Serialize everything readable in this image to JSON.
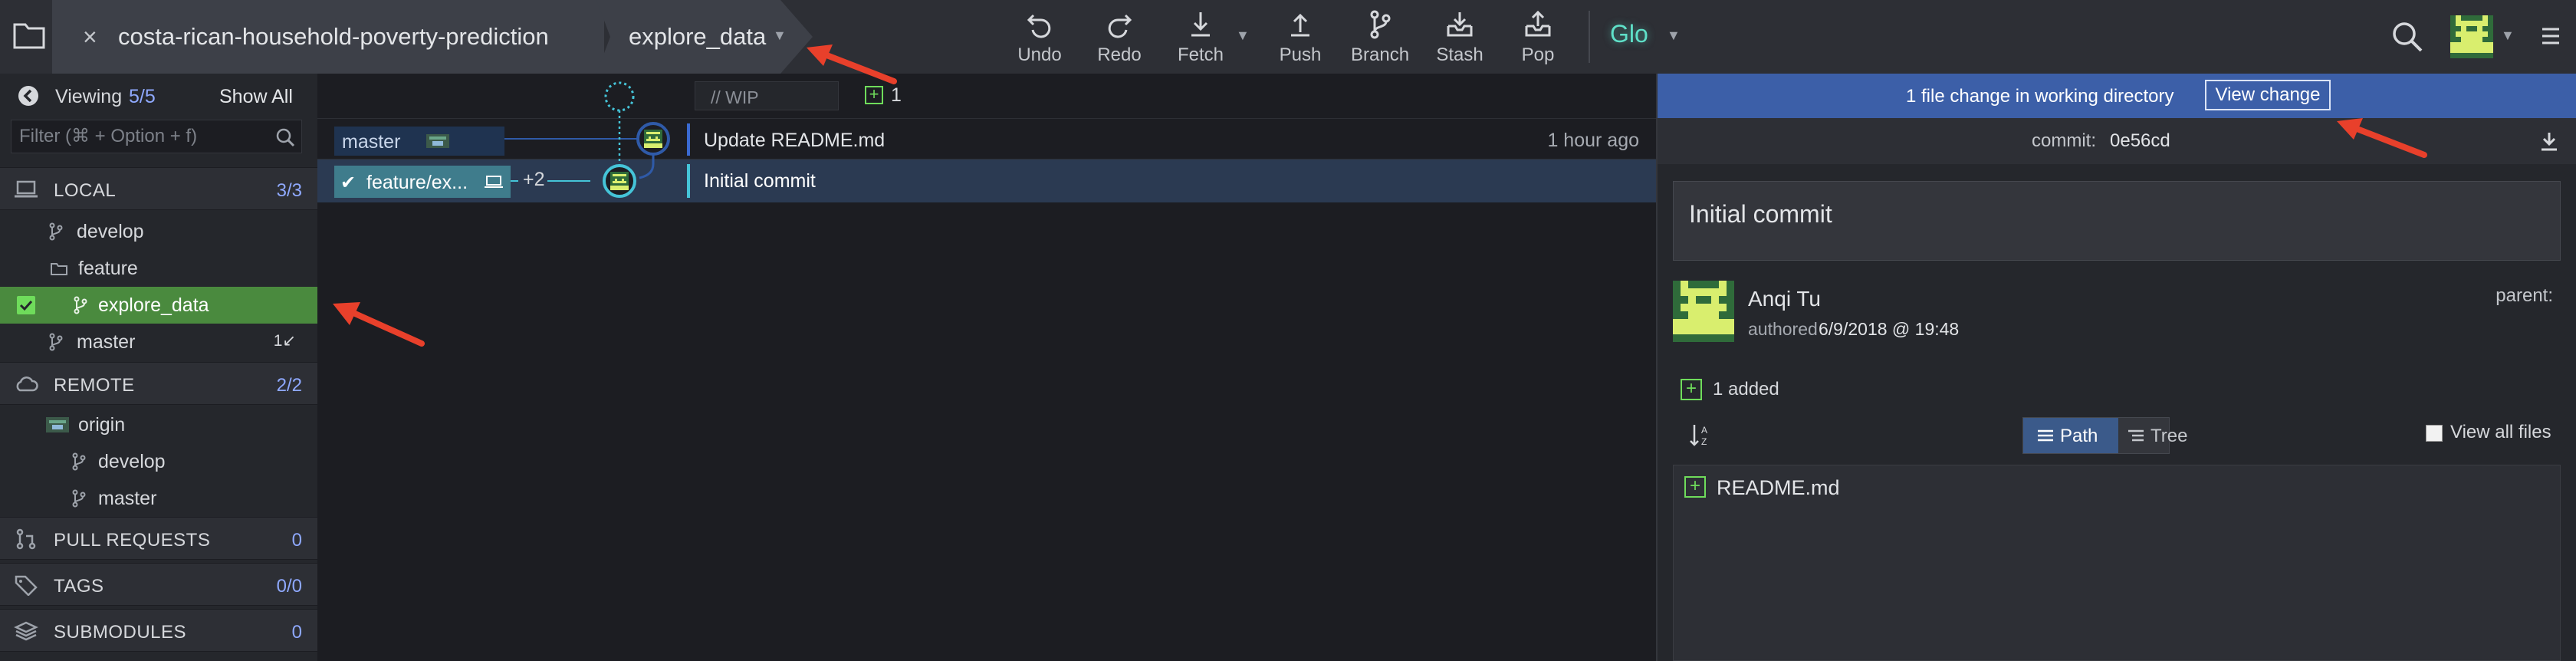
{
  "toolbar": {
    "repo_name": "costa-rican-household-poverty-prediction",
    "close_glyph": "×",
    "branch_name": "explore_data",
    "tools": [
      {
        "label": "Undo",
        "icon": "undo-icon"
      },
      {
        "label": "Redo",
        "icon": "redo-icon"
      },
      {
        "label": "Fetch",
        "icon": "fetch-icon"
      },
      {
        "label": "Push",
        "icon": "push-icon"
      },
      {
        "label": "Branch",
        "icon": "branch-icon"
      },
      {
        "label": "Stash",
        "icon": "stash-icon"
      },
      {
        "label": "Pop",
        "icon": "pop-icon"
      }
    ],
    "glo_label": "Glo"
  },
  "sidebar": {
    "viewing_label": "Viewing",
    "viewing_count": "5/5",
    "show_all": "Show All",
    "filter_placeholder": "Filter (⌘ + Option + f)",
    "local": {
      "title": "LOCAL",
      "count": "3/3"
    },
    "local_items": [
      {
        "label": "develop"
      },
      {
        "label": "feature"
      },
      {
        "label": "explore_data"
      },
      {
        "label": "master",
        "badge": "1↙"
      }
    ],
    "remote": {
      "title": "REMOTE",
      "count": "2/2"
    },
    "remote_items": [
      {
        "label": "origin"
      },
      {
        "label": "develop"
      },
      {
        "label": "master"
      }
    ],
    "pull_requests": {
      "title": "PULL REQUESTS",
      "count": "0"
    },
    "tags": {
      "title": "TAGS",
      "count": "0/0"
    },
    "submodules": {
      "title": "SUBMODULES",
      "count": "0"
    }
  },
  "graph": {
    "wip_placeholder": "// WIP",
    "wip_count": "1",
    "commits": [
      {
        "ref": "master",
        "message": "Update README.md",
        "time": "1 hour ago"
      },
      {
        "ref": "feature/ex...",
        "ref_extra": "+2",
        "message": "Initial commit",
        "time": ""
      }
    ]
  },
  "details": {
    "banner_text": "1 file change in working directory",
    "view_change": "View change",
    "commit_label": "commit:",
    "commit_sha": "0e56cd",
    "message": "Initial commit",
    "author": "Anqi Tu",
    "authored_label": "authored",
    "authored_date": "6/9/2018 @ 19:48",
    "parent_label": "parent:",
    "added_summary": "1 added",
    "view_path": "Path",
    "view_tree": "Tree",
    "view_all_files": "View all files",
    "files": [
      {
        "name": "README.md",
        "status": "added"
      }
    ]
  },
  "colors": {
    "accent_blue": "#3c5fa8",
    "added_green": "#6fdc5b",
    "active_branch": "#4a8a3e",
    "annotation_red": "#e8402b"
  }
}
